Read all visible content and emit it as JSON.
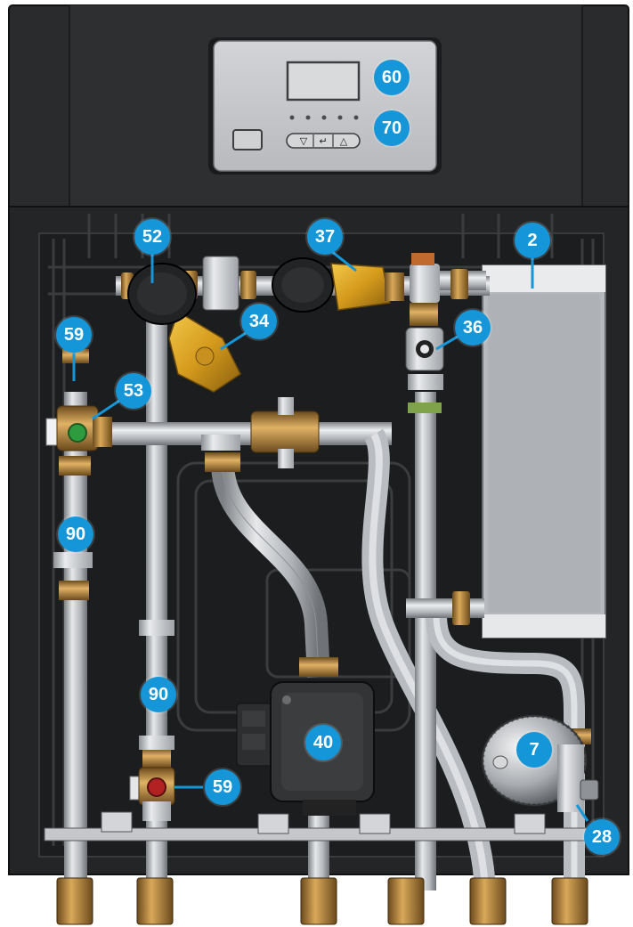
{
  "diagram": {
    "subject": "hydraulic module internal layout",
    "accent_color": "#1596d8",
    "pipe_color": "#b9bcc0",
    "brass_color": "#b8863a",
    "housing_color": "#262729",
    "panel_color": "#c3c5c8"
  },
  "control_panel": {
    "buttons": [
      "▽",
      "↵",
      "△"
    ],
    "indicator_dots": 5
  },
  "callouts": {
    "c60": "60",
    "c70": "70",
    "c52": "52",
    "c37": "37",
    "c2": "2",
    "c34": "34",
    "c36": "36",
    "c59_top": "59",
    "c53": "53",
    "c90_left": "90",
    "c90_mid": "90",
    "c40": "40",
    "c7": "7",
    "c59_bottom": "59",
    "c28": "28"
  }
}
